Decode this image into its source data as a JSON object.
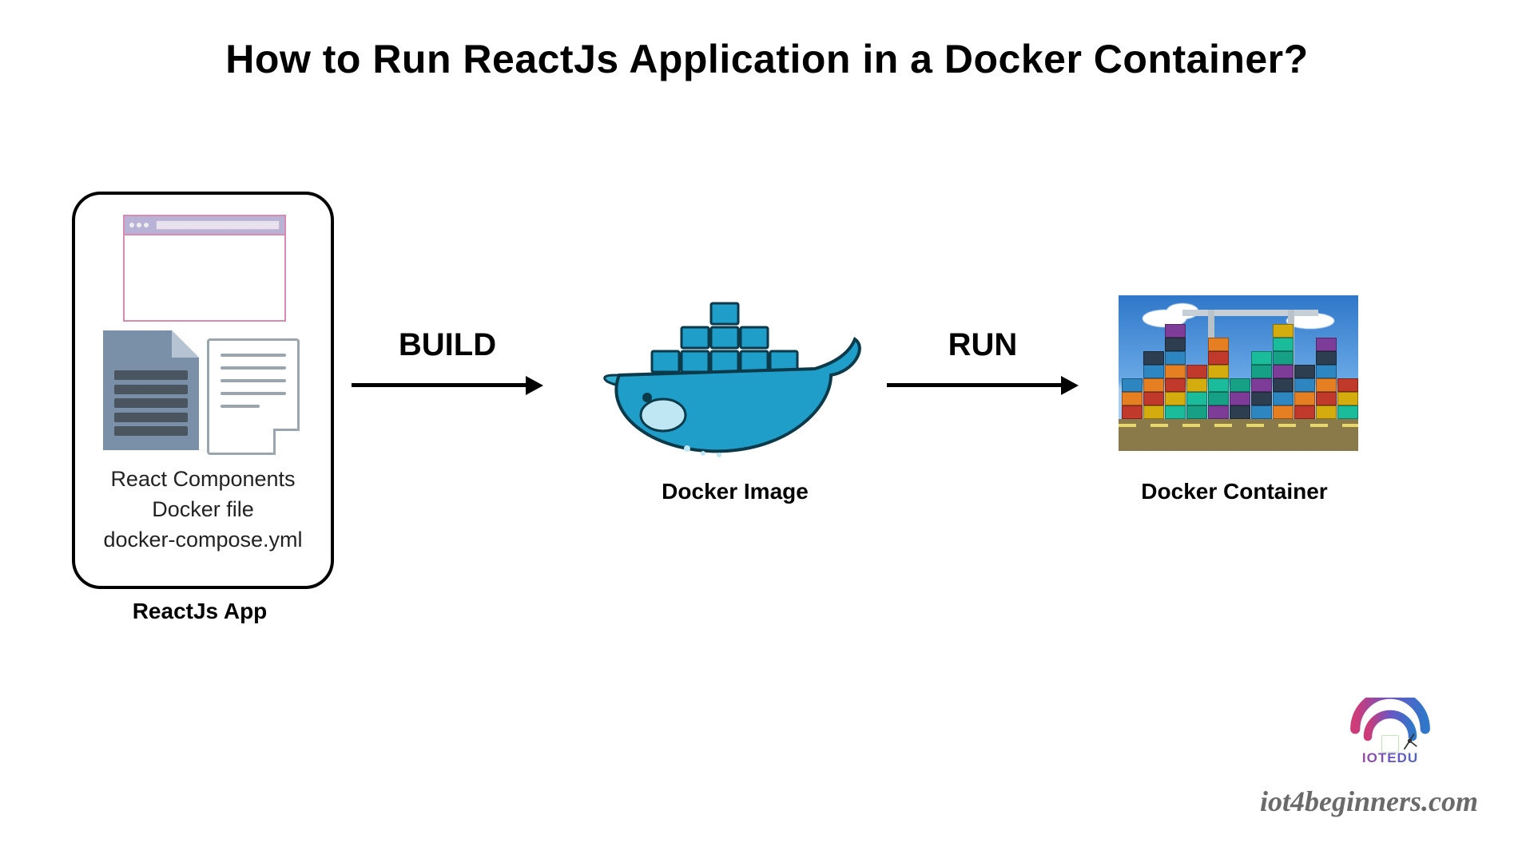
{
  "title": "How to Run ReactJs Application in a Docker Container?",
  "nodes": {
    "app": {
      "caption": "ReactJs App",
      "files": [
        "React Components",
        "Docker file",
        "docker-compose.yml"
      ]
    },
    "image": {
      "caption": "Docker Image"
    },
    "container": {
      "caption": "Docker Container"
    }
  },
  "arrows": {
    "build": "BUILD",
    "run": "RUN"
  },
  "watermark": {
    "brand": "IOTEDU",
    "site": "iot4beginners.com"
  },
  "yard_palette": [
    "#c0392b",
    "#16a085",
    "#2e86c1",
    "#d4ac0d",
    "#7d3c98",
    "#e67e22",
    "#1abc9c",
    "#2c3e50"
  ]
}
